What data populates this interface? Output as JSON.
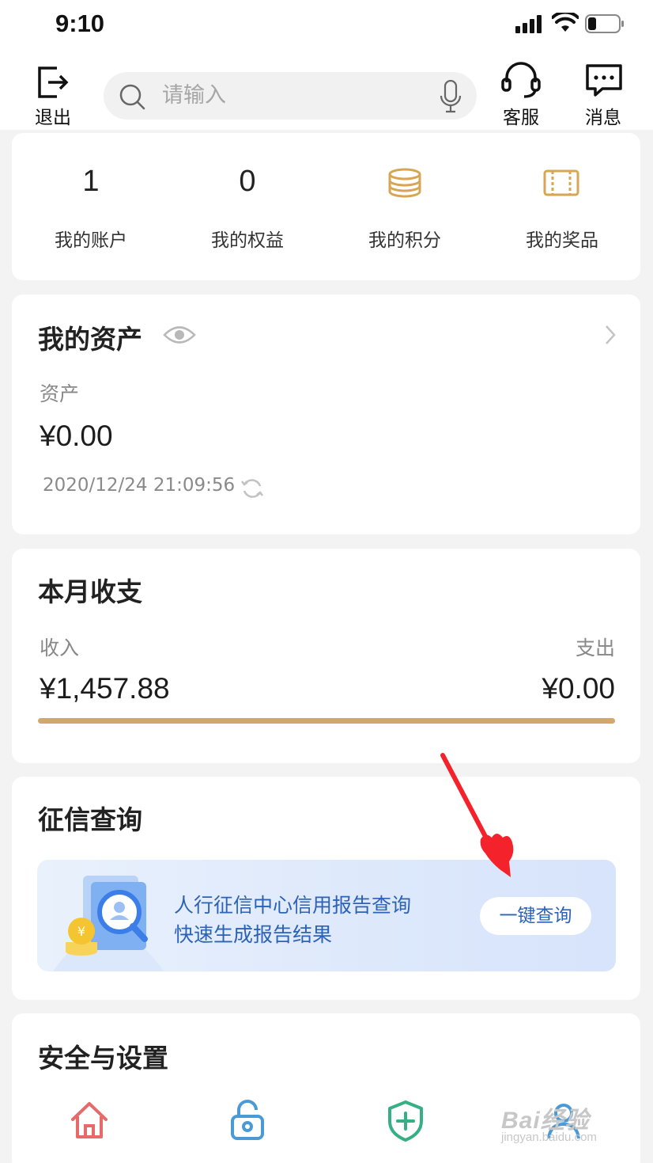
{
  "status_bar": {
    "time": "9:10"
  },
  "top_bar": {
    "logout_label": "退出",
    "search_placeholder": "请输入",
    "service_label": "客服",
    "messages_label": "消息"
  },
  "stats": [
    {
      "value": "1",
      "label": "我的账户"
    },
    {
      "value": "0",
      "label": "我的权益"
    },
    {
      "icon": "coins-icon",
      "label": "我的积分"
    },
    {
      "icon": "ticket-icon",
      "label": "我的奖品"
    }
  ],
  "assets": {
    "title": "我的资产",
    "asset_label": "资产",
    "asset_value": "¥0.00",
    "timestamp": "2020/12/24 21:09:56"
  },
  "monthly": {
    "title": "本月收支",
    "income_label": "收入",
    "income_value": "¥1,457.88",
    "expense_label": "支出",
    "expense_value": "¥0.00",
    "income_fraction": 1.0
  },
  "credit": {
    "title": "征信查询",
    "banner_line1": "人行征信中心信用报告查询",
    "banner_line2": "快速生成报告结果",
    "query_button": "一键查询"
  },
  "security": {
    "title": "安全与设置",
    "icons": [
      "home-icon",
      "lock-icon",
      "shield-plus-icon",
      "user-icon"
    ]
  },
  "watermark": {
    "line1": "Bai经验",
    "line2": "jingyan.baidu.com"
  },
  "colors": {
    "accent_gold": "#d3a66c",
    "banner_text": "#2d63b6",
    "arrow_red": "#f4222a"
  }
}
